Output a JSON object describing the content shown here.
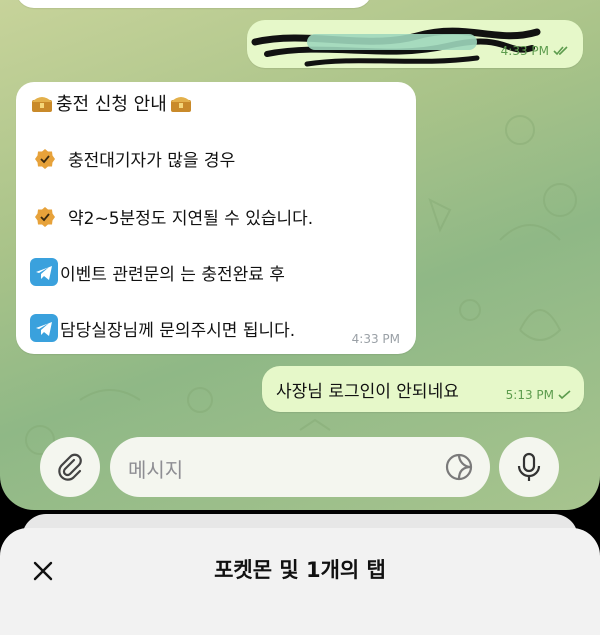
{
  "messages": {
    "out_top": {
      "time": "4:33 PM"
    },
    "incoming": {
      "title": "충전 신청 안내",
      "line1": "충전대기자가 많을 경우",
      "line2": "약2~5분정도 지연될 수 있습니다.",
      "line3": "이벤트 관련문의 는 충전완료 후",
      "line4": "담당실장님께 문의주시면 됩니다.",
      "time": "4:33 PM"
    },
    "out_bottom": {
      "text": "사장님 로그인이 안되네요",
      "time": "5:13 PM"
    }
  },
  "composer": {
    "placeholder": "메시지"
  },
  "sheet": {
    "title": "포켓몬 및 1개의 탭"
  },
  "icons": {
    "attach": "paperclip-icon",
    "sticker": "sticker-icon",
    "mic": "microphone-icon",
    "close": "close-icon",
    "verified": "verified-badge-icon",
    "telegram": "telegram-icon",
    "treasure": "treasure-chest-icon",
    "read": "double-check-icon"
  },
  "colors": {
    "accent": "#5d9c4e",
    "telegram": "#3aa1dd",
    "badge": "#e7a23a"
  }
}
